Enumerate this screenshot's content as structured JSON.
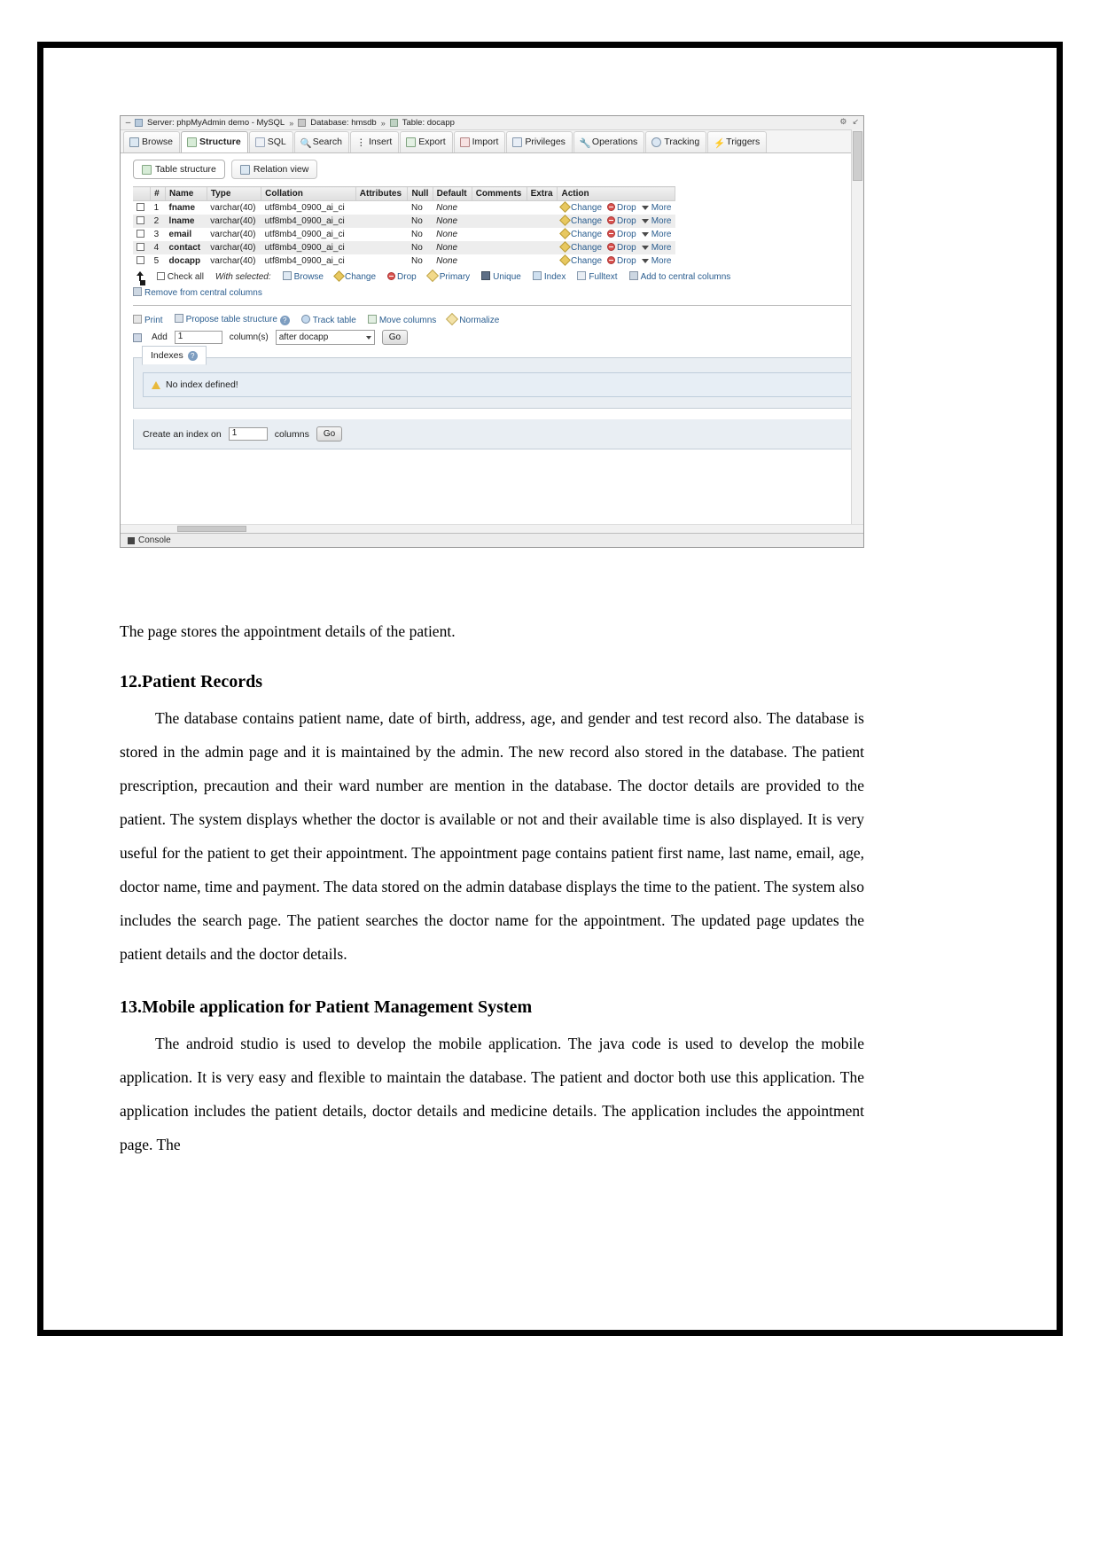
{
  "screenshot": {
    "titlebar": {
      "minimize": "–",
      "server_crumb": "Server: phpMyAdmin demo - MySQL",
      "database_crumb": "Database: hmsdb",
      "table_crumb": "Table: docapp",
      "separator": "»",
      "settings_icon": "gear-icon",
      "collapse_icon": "collapse-icon"
    },
    "tabs": [
      {
        "label": "Browse",
        "icon": "browse-icon",
        "active": false
      },
      {
        "label": "Structure",
        "icon": "structure-icon",
        "active": true
      },
      {
        "label": "SQL",
        "icon": "sql-icon",
        "active": false
      },
      {
        "label": "Search",
        "icon": "search-icon",
        "active": false
      },
      {
        "label": "Insert",
        "icon": "insert-icon",
        "active": false
      },
      {
        "label": "Export",
        "icon": "export-icon",
        "active": false
      },
      {
        "label": "Import",
        "icon": "import-icon",
        "active": false
      },
      {
        "label": "Privileges",
        "icon": "privileges-icon",
        "active": false
      },
      {
        "label": "Operations",
        "icon": "operations-icon",
        "active": false
      },
      {
        "label": "Tracking",
        "icon": "tracking-icon",
        "active": false
      },
      {
        "label": "Triggers",
        "icon": "triggers-icon",
        "active": false
      }
    ],
    "subtabs": [
      {
        "label": "Table structure",
        "icon": "table-structure-icon",
        "active": true
      },
      {
        "label": "Relation view",
        "icon": "relation-view-icon",
        "active": false
      }
    ],
    "structure_table": {
      "headers": [
        "",
        "#",
        "Name",
        "Type",
        "Collation",
        "Attributes",
        "Null",
        "Default",
        "Comments",
        "Extra",
        "Action"
      ],
      "rows": [
        {
          "num": "1",
          "name": "fname",
          "type": "varchar(40)",
          "collation": "utf8mb4_0900_ai_ci",
          "attributes": "",
          "null": "No",
          "default": "None",
          "comments": "",
          "extra": "",
          "actions": [
            "Change",
            "Drop",
            "More"
          ]
        },
        {
          "num": "2",
          "name": "lname",
          "type": "varchar(40)",
          "collation": "utf8mb4_0900_ai_ci",
          "attributes": "",
          "null": "No",
          "default": "None",
          "comments": "",
          "extra": "",
          "actions": [
            "Change",
            "Drop",
            "More"
          ]
        },
        {
          "num": "3",
          "name": "email",
          "type": "varchar(40)",
          "collation": "utf8mb4_0900_ai_ci",
          "attributes": "",
          "null": "No",
          "default": "None",
          "comments": "",
          "extra": "",
          "actions": [
            "Change",
            "Drop",
            "More"
          ]
        },
        {
          "num": "4",
          "name": "contact",
          "type": "varchar(40)",
          "collation": "utf8mb4_0900_ai_ci",
          "attributes": "",
          "null": "No",
          "default": "None",
          "comments": "",
          "extra": "",
          "actions": [
            "Change",
            "Drop",
            "More"
          ]
        },
        {
          "num": "5",
          "name": "docapp",
          "type": "varchar(40)",
          "collation": "utf8mb4_0900_ai_ci",
          "attributes": "",
          "null": "No",
          "default": "None",
          "comments": "",
          "extra": "",
          "actions": [
            "Change",
            "Drop",
            "More"
          ]
        }
      ]
    },
    "with_selected": {
      "check_all": "Check all",
      "label": "With selected:",
      "actions": [
        "Browse",
        "Change",
        "Drop",
        "Primary",
        "Unique",
        "Index",
        "Fulltext",
        "Add to central columns"
      ],
      "remove_from_central": "Remove from central columns"
    },
    "bottom_tools": [
      "Print",
      "Propose table structure",
      "Track table",
      "Move columns",
      "Normalize"
    ],
    "add_column": {
      "add_label": "Add",
      "count_value": "1",
      "columns_label": "column(s)",
      "position_value": "after docapp",
      "go_label": "Go"
    },
    "indexes_panel": {
      "tab_label": "Indexes",
      "no_index_message": "No index defined!",
      "create_label": "Create an index on",
      "create_value": "1",
      "columns_label": "columns",
      "go_label": "Go"
    },
    "console_label": "Console"
  },
  "document": {
    "caption": "The page stores the appointment details of the patient.",
    "sections": [
      {
        "heading": "12.Patient Records",
        "body": "The database contains patient name, date of birth, address, age, and gender and test record also. The database is stored in the admin page and it is maintained by the admin. The new record also stored in the database. The patient prescription, precaution and their ward number are mention in the database. The doctor details are provided to the patient. The system displays whether the doctor is available or not and their available time is also displayed. It is very useful for the patient to get their appointment. The appointment page contains patient first name, last name, email, age, doctor name, time and payment. The data stored on the admin database displays the time to the patient. The system also includes the search page. The patient searches the doctor name for the appointment. The updated page updates the patient details and the doctor details."
      },
      {
        "heading": "13.Mobile application for Patient Management System",
        "body": "The android studio is used to develop the mobile application. The java code is used to develop the mobile application. It is very easy and flexible to maintain the database. The patient and doctor both use this application. The application includes the patient details, doctor details and medicine details. The application includes the appointment page. The"
      }
    ]
  }
}
